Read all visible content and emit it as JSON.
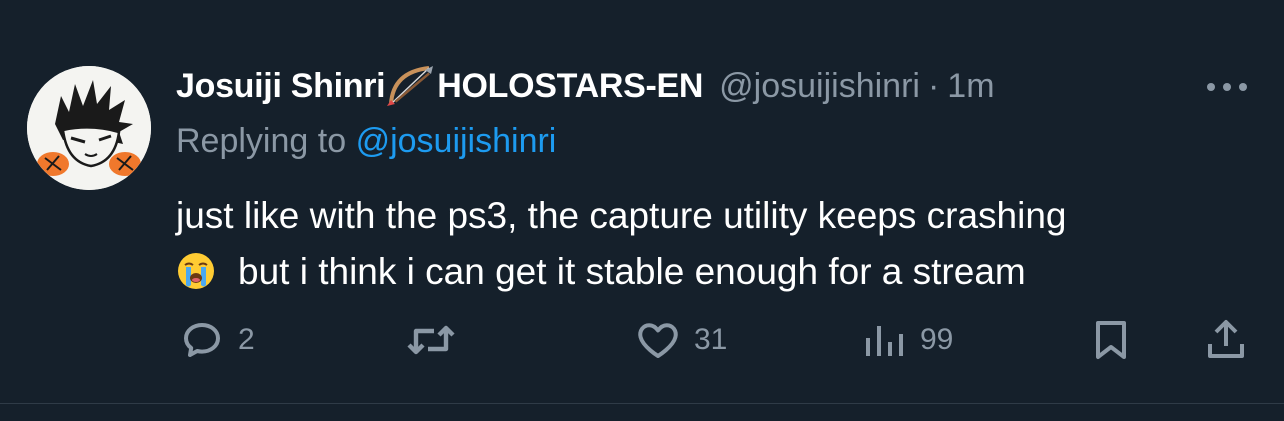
{
  "tweet": {
    "display_name": "Josuiji Shinri",
    "display_name_suffix": "HOLOSTARS-EN",
    "name_emoji": "bow-and-arrow",
    "handle": "@josuijishinri",
    "separator": "·",
    "time": "1m",
    "replying_prefix": "Replying to",
    "replying_to": "@josuijishinri",
    "text_line1": "just like with the ps3, the capture utility keeps crashing",
    "text_line2": "but i think i can get it stable enough for a stream",
    "text_emoji": "loudly-crying-face"
  },
  "actions": {
    "reply_count": "2",
    "retweet_count": "",
    "like_count": "31",
    "views_count": "99"
  },
  "colors": {
    "background": "#15202b",
    "primary_text": "#ffffff",
    "secondary_text": "#8b98a5",
    "link": "#1d9bf0"
  }
}
